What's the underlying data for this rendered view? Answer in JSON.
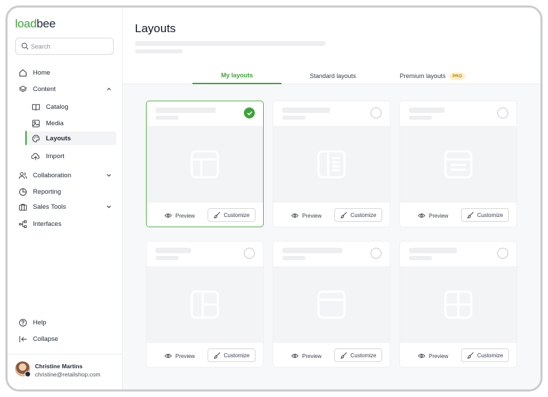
{
  "brand": {
    "part1": "load",
    "part2": "bee",
    "accent": "#3fa33a"
  },
  "search": {
    "placeholder": "Search",
    "value": ""
  },
  "nav": {
    "home": "Home",
    "content": "Content",
    "catalog": "Catalog",
    "media": "Media",
    "layouts": "Layouts",
    "import": "Import",
    "collaboration": "Collaboration",
    "reporting": "Reporting",
    "sales_tools": "Sales Tools",
    "interfaces": "Interfaces",
    "help": "Help",
    "collapse": "Collapse"
  },
  "user": {
    "name": "Christine Martins",
    "email": "christine@retailshop.com"
  },
  "page": {
    "title": "Layouts"
  },
  "tabs": {
    "my_layouts": "My layouts",
    "standard_layouts": "Standard layouts",
    "premium_layouts": "Premium layouts",
    "pro_badge": "PRO"
  },
  "cards": [
    {
      "icon": "layout-header-sidebar-icon",
      "preview_label": "Preview",
      "customize_label": "Customize",
      "selected": true
    },
    {
      "icon": "layout-sidebar-list-icon",
      "preview_label": "Preview",
      "customize_label": "Customize",
      "selected": false
    },
    {
      "icon": "layout-rows-icon",
      "preview_label": "Preview",
      "customize_label": "Customize",
      "selected": false
    },
    {
      "icon": "layout-left-column-grid-icon",
      "preview_label": "Preview",
      "customize_label": "Customize",
      "selected": false
    },
    {
      "icon": "layout-header-body-icon",
      "preview_label": "Preview",
      "customize_label": "Customize",
      "selected": false
    },
    {
      "icon": "layout-four-grid-icon",
      "preview_label": "Preview",
      "customize_label": "Customize",
      "selected": false
    }
  ]
}
